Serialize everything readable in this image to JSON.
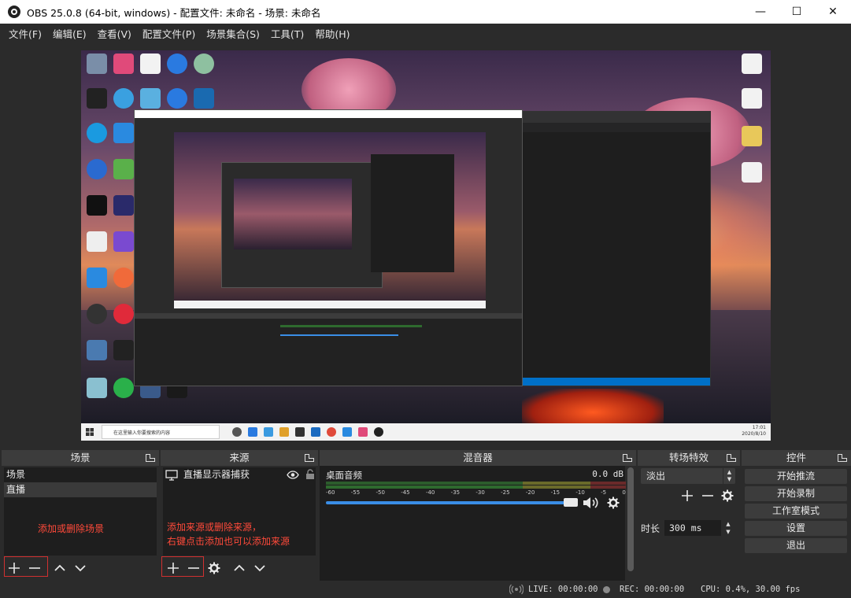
{
  "window": {
    "title": "OBS 25.0.8 (64-bit, windows) - 配置文件: 未命名 - 场景: 未命名",
    "minimize": "—",
    "maximize": "☐",
    "close": "✕"
  },
  "menu": [
    "文件(F)",
    "编辑(E)",
    "查看(V)",
    "配置文件(P)",
    "场景集合(S)",
    "工具(T)",
    "帮助(H)"
  ],
  "preview": {
    "taskbar_search": "在这里输入你要搜索的内容",
    "clock_time": "17:01",
    "clock_date": "2020/8/10"
  },
  "scenes": {
    "header": "场景",
    "items": [
      "场景",
      "直播"
    ],
    "selected_index": 1,
    "hint": "添加或删除场景"
  },
  "sources": {
    "header": "来源",
    "items": [
      {
        "name": "直播显示器捕获",
        "visible": true,
        "locked": false
      }
    ],
    "hint_line1": "添加来源或删除来源，",
    "hint_line2": "右键点击添加也可以添加来源"
  },
  "mixer": {
    "header": "混音器",
    "track_name": "桌面音频",
    "level": "0.0 dB",
    "ticks": [
      "-60",
      "-55",
      "-50",
      "-45",
      "-40",
      "-35",
      "-30",
      "-25",
      "-20",
      "-15",
      "-10",
      "-5",
      "0"
    ],
    "volume_fraction": 1.0
  },
  "transitions": {
    "header": "转场特效",
    "selected": "淡出",
    "duration_label": "时长",
    "duration_value": "300 ms"
  },
  "controls": {
    "header": "控件",
    "buttons": [
      "开始推流",
      "开始录制",
      "工作室模式",
      "设置",
      "退出"
    ]
  },
  "status": {
    "live": "LIVE: 00:00:00",
    "rec": "REC: 00:00:00",
    "cpu": "CPU: 0.4%, 30.00 fps"
  },
  "colors": {
    "hint_red": "#ff4a3a",
    "volume_blue": "#3a8ee6"
  }
}
